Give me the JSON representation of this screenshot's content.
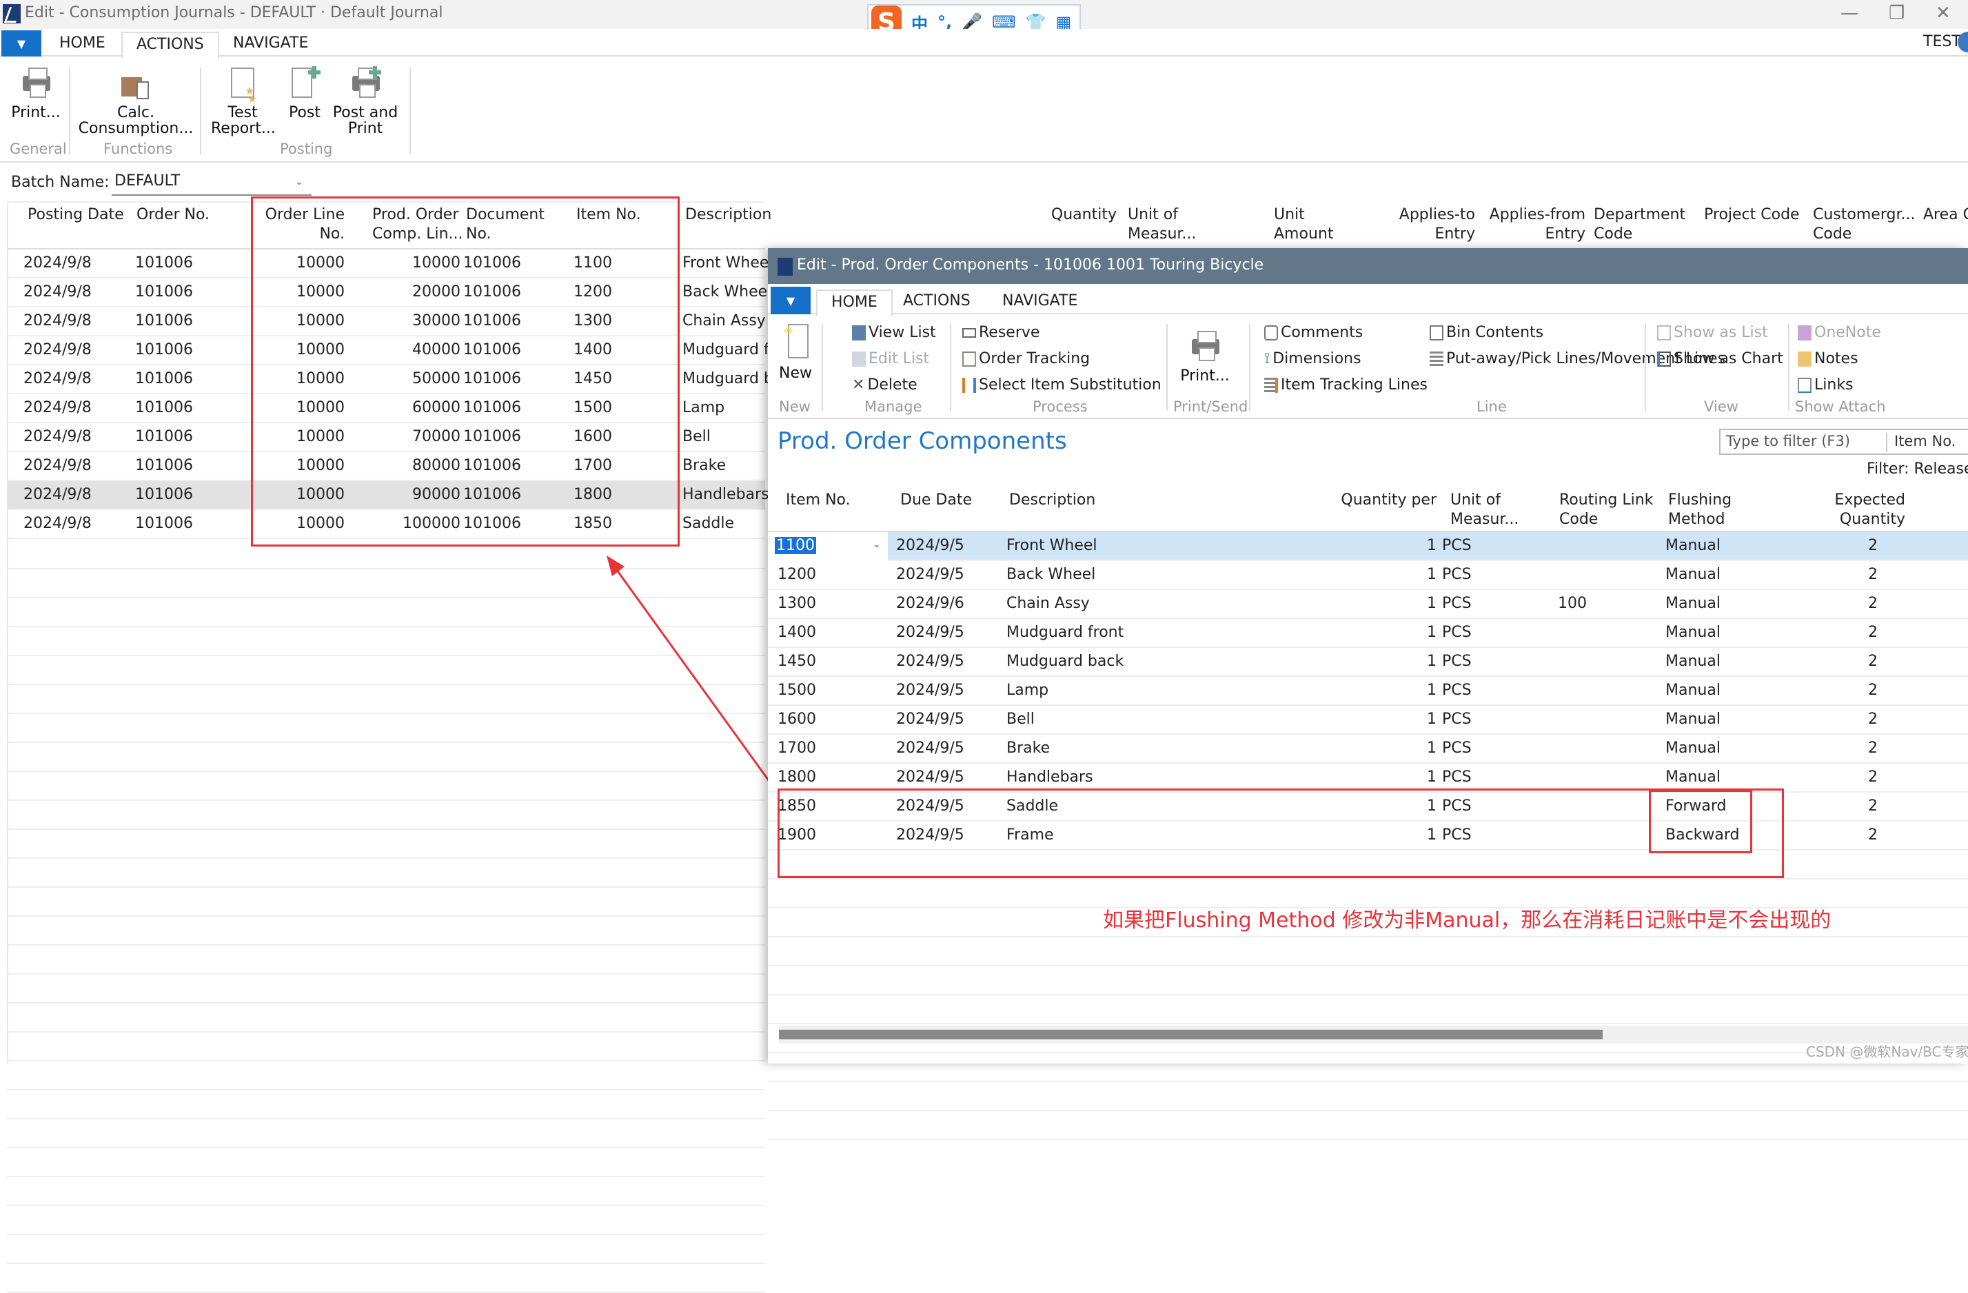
{
  "main_window": {
    "title": "Edit - Consumption Journals - DEFAULT · Default Journal",
    "window_controls": {
      "minimize": "—",
      "restore": "❐",
      "close": "✕"
    },
    "user": "TEST",
    "menu_tabs": [
      {
        "label": "HOME",
        "active": false
      },
      {
        "label": "ACTIONS",
        "active": true
      },
      {
        "label": "NAVIGATE",
        "active": false
      }
    ],
    "ribbon": {
      "groups": [
        {
          "label": "General",
          "buttons": [
            {
              "label_1": "Print...",
              "label_2": "",
              "icon": "printer-icon"
            }
          ]
        },
        {
          "label": "Functions",
          "buttons": [
            {
              "label_1": "Calc.",
              "label_2": "Consumption...",
              "icon": "calc-consumption-icon"
            }
          ]
        },
        {
          "label": "Posting",
          "buttons": [
            {
              "label_1": "Test",
              "label_2": "Report...",
              "icon": "test-report-icon"
            },
            {
              "label_1": "Post",
              "label_2": "",
              "icon": "post-icon"
            },
            {
              "label_1": "Post and",
              "label_2": "Print",
              "icon": "post-print-icon"
            }
          ]
        }
      ]
    },
    "batch": {
      "label": "Batch Name:",
      "value": "DEFAULT"
    },
    "grid": {
      "headers": [
        {
          "l1": "Posting Date",
          "l2": ""
        },
        {
          "l1": "Order No.",
          "l2": ""
        },
        {
          "l1": "Order Line",
          "l2": "No."
        },
        {
          "l1": "Prod. Order",
          "l2": "Comp. Lin..."
        },
        {
          "l1": "Document",
          "l2": "No."
        },
        {
          "l1": "Item No.",
          "l2": ""
        },
        {
          "l1": "Description",
          "l2": ""
        },
        {
          "l1": "Quantity",
          "l2": ""
        },
        {
          "l1": "Unit of",
          "l2": "Measur..."
        },
        {
          "l1": "Unit Amount",
          "l2": ""
        },
        {
          "l1": "Applies-to",
          "l2": "Entry"
        },
        {
          "l1": "Applies-from",
          "l2": "Entry"
        },
        {
          "l1": "Department",
          "l2": "Code"
        },
        {
          "l1": "Project Code",
          "l2": ""
        },
        {
          "l1": "Customergr...",
          "l2": "Code"
        },
        {
          "l1": "Area C",
          "l2": ""
        }
      ],
      "rows": [
        {
          "posting_date": "2024/9/8",
          "order_no": "101006",
          "order_line_no": "10000",
          "comp_line": "10000",
          "document_no": "101006",
          "item_no": "1100",
          "description": "Front Wheel",
          "selected": false
        },
        {
          "posting_date": "2024/9/8",
          "order_no": "101006",
          "order_line_no": "10000",
          "comp_line": "20000",
          "document_no": "101006",
          "item_no": "1200",
          "description": "Back Wheel",
          "selected": false
        },
        {
          "posting_date": "2024/9/8",
          "order_no": "101006",
          "order_line_no": "10000",
          "comp_line": "30000",
          "document_no": "101006",
          "item_no": "1300",
          "description": "Chain Assy",
          "selected": false
        },
        {
          "posting_date": "2024/9/8",
          "order_no": "101006",
          "order_line_no": "10000",
          "comp_line": "40000",
          "document_no": "101006",
          "item_no": "1400",
          "description": "Mudguard front",
          "selected": false
        },
        {
          "posting_date": "2024/9/8",
          "order_no": "101006",
          "order_line_no": "10000",
          "comp_line": "50000",
          "document_no": "101006",
          "item_no": "1450",
          "description": "Mudguard back",
          "selected": false
        },
        {
          "posting_date": "2024/9/8",
          "order_no": "101006",
          "order_line_no": "10000",
          "comp_line": "60000",
          "document_no": "101006",
          "item_no": "1500",
          "description": "Lamp",
          "selected": false
        },
        {
          "posting_date": "2024/9/8",
          "order_no": "101006",
          "order_line_no": "10000",
          "comp_line": "70000",
          "document_no": "101006",
          "item_no": "1600",
          "description": "Bell",
          "selected": false
        },
        {
          "posting_date": "2024/9/8",
          "order_no": "101006",
          "order_line_no": "10000",
          "comp_line": "80000",
          "document_no": "101006",
          "item_no": "1700",
          "description": "Brake",
          "selected": false
        },
        {
          "posting_date": "2024/9/8",
          "order_no": "101006",
          "order_line_no": "10000",
          "comp_line": "90000",
          "document_no": "101006",
          "item_no": "1800",
          "description": "Handlebars",
          "selected": true
        },
        {
          "posting_date": "2024/9/8",
          "order_no": "101006",
          "order_line_no": "10000",
          "comp_line": "100000",
          "document_no": "101006",
          "item_no": "1850",
          "description": "Saddle",
          "selected": false
        }
      ]
    }
  },
  "popup_window": {
    "title": "Edit - Prod. Order Components - 101006 1001 Touring Bicycle",
    "menu_tabs": [
      {
        "label": "HOME",
        "active": true
      },
      {
        "label": "ACTIONS",
        "active": false
      },
      {
        "label": "NAVIGATE",
        "active": false
      }
    ],
    "ribbon": {
      "new": "New",
      "manage": [
        "View List",
        "Edit List",
        "Delete"
      ],
      "process": [
        "Reserve",
        "Order Tracking",
        "Select Item Substitution"
      ],
      "print": "Print...",
      "line_col1": [
        "Comments",
        "Dimensions",
        "Item Tracking Lines"
      ],
      "line_col2": [
        "Bin Contents",
        "Put-away/Pick Lines/Movement Lines"
      ],
      "view": [
        "Show as List",
        "Show as Chart"
      ],
      "attach": [
        "OneNote",
        "Notes",
        "Links"
      ],
      "group_labels": [
        "New",
        "Manage",
        "Process",
        "Print/Send",
        "Line",
        "View",
        "Show Attach"
      ]
    },
    "page_title": "Prod. Order Components",
    "filter": {
      "placeholder": "Type to filter (F3)",
      "field": "Item No.",
      "status": "Filter: Released"
    },
    "headers": [
      {
        "l1": "Item No.",
        "l2": ""
      },
      {
        "l1": "Due Date",
        "l2": ""
      },
      {
        "l1": "Description",
        "l2": ""
      },
      {
        "l1": "Quantity per",
        "l2": ""
      },
      {
        "l1": "Unit of",
        "l2": "Measur..."
      },
      {
        "l1": "Routing Link",
        "l2": "Code"
      },
      {
        "l1": "Flushing",
        "l2": "Method"
      },
      {
        "l1": "Expected",
        "l2": "Quantity"
      }
    ],
    "rows": [
      {
        "item_no": "1100",
        "due_date": "2024/9/5",
        "description": "Front Wheel",
        "qty_per": "1",
        "uom": "PCS",
        "routing_link": "",
        "flushing": "Manual",
        "expected_qty": "2",
        "selected": true
      },
      {
        "item_no": "1200",
        "due_date": "2024/9/5",
        "description": "Back Wheel",
        "qty_per": "1",
        "uom": "PCS",
        "routing_link": "",
        "flushing": "Manual",
        "expected_qty": "2",
        "selected": false
      },
      {
        "item_no": "1300",
        "due_date": "2024/9/6",
        "description": "Chain Assy",
        "qty_per": "1",
        "uom": "PCS",
        "routing_link": "100",
        "flushing": "Manual",
        "expected_qty": "2",
        "selected": false
      },
      {
        "item_no": "1400",
        "due_date": "2024/9/5",
        "description": "Mudguard front",
        "qty_per": "1",
        "uom": "PCS",
        "routing_link": "",
        "flushing": "Manual",
        "expected_qty": "2",
        "selected": false
      },
      {
        "item_no": "1450",
        "due_date": "2024/9/5",
        "description": "Mudguard back",
        "qty_per": "1",
        "uom": "PCS",
        "routing_link": "",
        "flushing": "Manual",
        "expected_qty": "2",
        "selected": false
      },
      {
        "item_no": "1500",
        "due_date": "2024/9/5",
        "description": "Lamp",
        "qty_per": "1",
        "uom": "PCS",
        "routing_link": "",
        "flushing": "Manual",
        "expected_qty": "2",
        "selected": false
      },
      {
        "item_no": "1600",
        "due_date": "2024/9/5",
        "description": "Bell",
        "qty_per": "1",
        "uom": "PCS",
        "routing_link": "",
        "flushing": "Manual",
        "expected_qty": "2",
        "selected": false
      },
      {
        "item_no": "1700",
        "due_date": "2024/9/5",
        "description": "Brake",
        "qty_per": "1",
        "uom": "PCS",
        "routing_link": "",
        "flushing": "Manual",
        "expected_qty": "2",
        "selected": false
      },
      {
        "item_no": "1800",
        "due_date": "2024/9/5",
        "description": "Handlebars",
        "qty_per": "1",
        "uom": "PCS",
        "routing_link": "",
        "flushing": "Manual",
        "expected_qty": "2",
        "selected": false
      },
      {
        "item_no": "1850",
        "due_date": "2024/9/5",
        "description": "Saddle",
        "qty_per": "1",
        "uom": "PCS",
        "routing_link": "",
        "flushing": "Forward",
        "expected_qty": "2",
        "selected": false
      },
      {
        "item_no": "1900",
        "due_date": "2024/9/5",
        "description": "Frame",
        "qty_per": "1",
        "uom": "PCS",
        "routing_link": "",
        "flushing": "Backward",
        "expected_qty": "2",
        "selected": false
      }
    ]
  },
  "annotation": {
    "note": "如果把Flushing Method 修改为非Manual，那么在消耗日记账中是不会出现的",
    "color": "#e8333b"
  },
  "ime_toolbar": {
    "logo": "S",
    "glyphs": [
      "中",
      "°,",
      "🎤",
      "⌨",
      "👕",
      "▦"
    ]
  },
  "watermark": "CSDN @微软Nav/BC专家"
}
